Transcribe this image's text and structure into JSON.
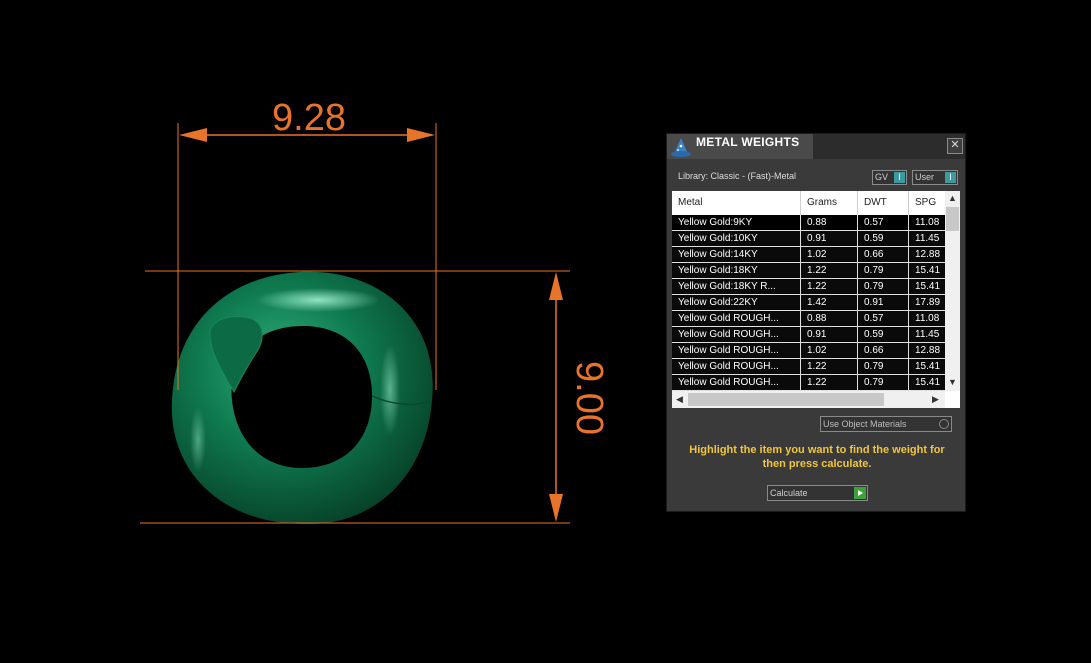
{
  "viewport": {
    "width_dimension": "9.28",
    "height_dimension": "9.00",
    "object_color": "#0e6a45",
    "dimension_color": "#e8742c"
  },
  "panel": {
    "title": "METAL WEIGHTS",
    "close_icon": "close-icon",
    "library_label": "Library: Classic - (Fast)-Metal",
    "gv_label": "GV",
    "user_label": "User",
    "table": {
      "columns": [
        "Metal",
        "Grams",
        "DWT",
        "SPG"
      ],
      "rows": [
        [
          "Yellow Gold:9KY",
          "0.88",
          "0.57",
          "11.08"
        ],
        [
          "Yellow Gold:10KY",
          "0.91",
          "0.59",
          "11.45"
        ],
        [
          "Yellow Gold:14KY",
          "1.02",
          "0.66",
          "12.88"
        ],
        [
          "Yellow Gold:18KY",
          "1.22",
          "0.79",
          "15.41"
        ],
        [
          "Yellow Gold:18KY R...",
          "1.22",
          "0.79",
          "15.41"
        ],
        [
          "Yellow Gold:22KY",
          "1.42",
          "0.91",
          "17.89"
        ],
        [
          "Yellow Gold ROUGH...",
          "0.88",
          "0.57",
          "11.08"
        ],
        [
          "Yellow Gold ROUGH...",
          "0.91",
          "0.59",
          "11.45"
        ],
        [
          "Yellow Gold ROUGH...",
          "1.02",
          "0.66",
          "12.88"
        ],
        [
          "Yellow Gold ROUGH...",
          "1.22",
          "0.79",
          "15.41"
        ],
        [
          "Yellow Gold ROUGH...",
          "1.22",
          "0.79",
          "15.41"
        ]
      ]
    },
    "use_object_materials_label": "Use Object Materials",
    "hint": "Highlight the item you want to find the weight for then press calculate.",
    "calculate_label": "Calculate",
    "accent_color": "#3d9aa0",
    "hint_color": "#f0c63c"
  }
}
